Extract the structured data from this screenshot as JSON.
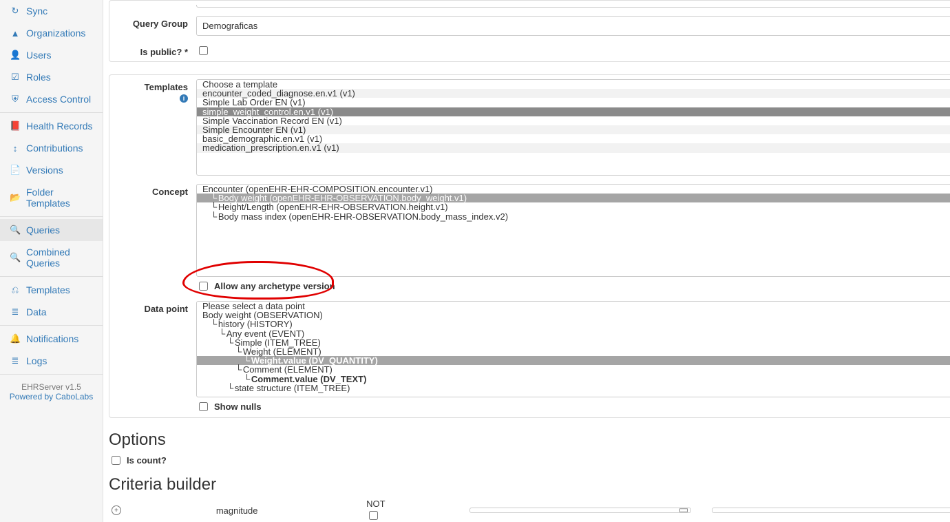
{
  "sidebar": {
    "items": [
      {
        "label": "Sync",
        "icon": "↻"
      },
      {
        "label": "Organizations",
        "icon": "▲"
      },
      {
        "label": "Users",
        "icon": "👤"
      },
      {
        "label": "Roles",
        "icon": "☑"
      },
      {
        "label": "Access Control",
        "icon": "⛨"
      },
      {
        "label": "Health Records",
        "icon": "📕"
      },
      {
        "label": "Contributions",
        "icon": "↕"
      },
      {
        "label": "Versions",
        "icon": "📄"
      },
      {
        "label": "Folder Templates",
        "icon": "📂"
      },
      {
        "label": "Queries",
        "icon": "🔍"
      },
      {
        "label": "Combined Queries",
        "icon": "🔍"
      },
      {
        "label": "Templates",
        "icon": "⎌"
      },
      {
        "label": "Data",
        "icon": "≣"
      },
      {
        "label": "Notifications",
        "icon": "🔔"
      },
      {
        "label": "Logs",
        "icon": "≣"
      }
    ],
    "footer_version": "EHRServer v1.5",
    "footer_powered": "Powered by CaboLabs"
  },
  "form": {
    "query_group_label": "Query Group",
    "query_group_value": "Demograficas",
    "is_public_label": "Is public? *",
    "templates_label": "Templates",
    "templates": [
      "Choose a template",
      "encounter_coded_diagnose.en.v1 (v1)",
      "Simple Lab Order EN (v1)",
      "simple_weight_control.en.v1 (v1)",
      "Simple Vaccination Record EN (v1)",
      "Simple Encounter EN (v1)",
      "basic_demographic.en.v1 (v1)",
      "medication_prescription.en.v1 (v1)"
    ],
    "templates_selected_index": 3,
    "concept_label": "Concept",
    "concepts": [
      "Encounter (openEHR-EHR-COMPOSITION.encounter.v1)",
      "Body weight (openEHR-EHR-OBSERVATION.body_weight.v1)",
      "Height/Length (openEHR-EHR-OBSERVATION.height.v1)",
      "Body mass index (openEHR-EHR-OBSERVATION.body_mass_index.v2)"
    ],
    "allow_any_label": "Allow any archetype version",
    "datapoint_label": "Data point",
    "datapoints": [
      "Please select a data point",
      "Body weight (OBSERVATION)",
      "history (HISTORY)",
      "Any event (EVENT)",
      "Simple (ITEM_TREE)",
      "Weight (ELEMENT)",
      "Weight.value (DV_QUANTITY)",
      "Comment (ELEMENT)",
      "Comment.value (DV_TEXT)",
      "state structure (ITEM_TREE)"
    ],
    "show_nulls_label": "Show nulls"
  },
  "options": {
    "title": "Options",
    "is_count_label": "Is count?"
  },
  "criteria": {
    "title": "Criteria builder",
    "field": "magnitude",
    "not_label": "NOT"
  }
}
